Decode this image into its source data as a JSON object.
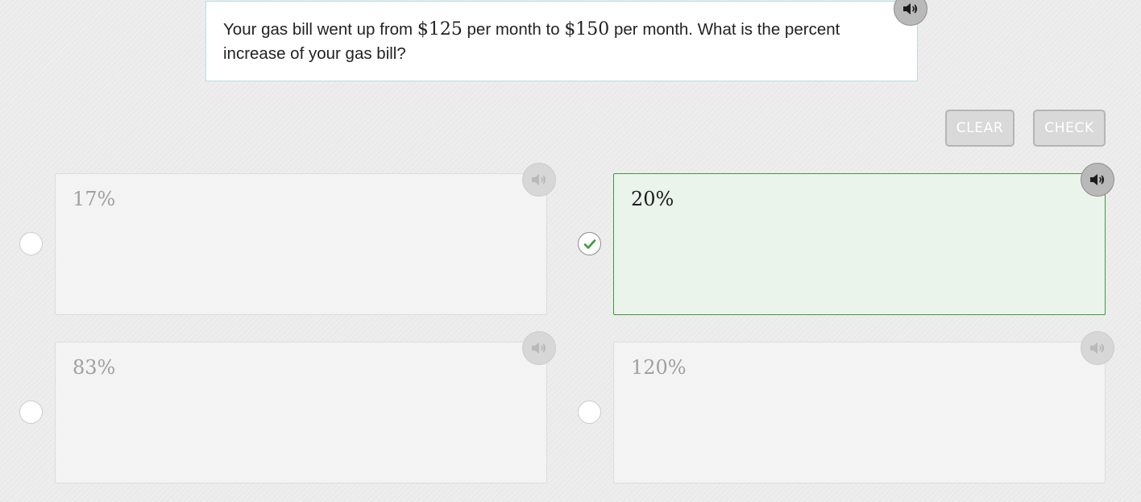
{
  "question": {
    "text_part1": "Your gas bill went up from ",
    "value1": "$125",
    "text_part2": " per month to ",
    "value2": "$150",
    "text_part3": " per month. What is the percent increase of your gas bill?"
  },
  "toolbar": {
    "clear_label": "CLEAR",
    "check_label": "CHECK"
  },
  "options": [
    {
      "label": "17%",
      "selected": false
    },
    {
      "label": "20%",
      "selected": true
    },
    {
      "label": "83%",
      "selected": false
    },
    {
      "label": "120%",
      "selected": false
    }
  ],
  "icons": {
    "audio": "speaker-icon",
    "selected_mark": "checkmark-icon"
  },
  "colors": {
    "selected_border": "#3d9a3d",
    "selected_background": "#eaf4eb",
    "checkmark": "#3c9a3c",
    "question_border": "#b7dde4",
    "button_fill": "#d9d9d9"
  }
}
